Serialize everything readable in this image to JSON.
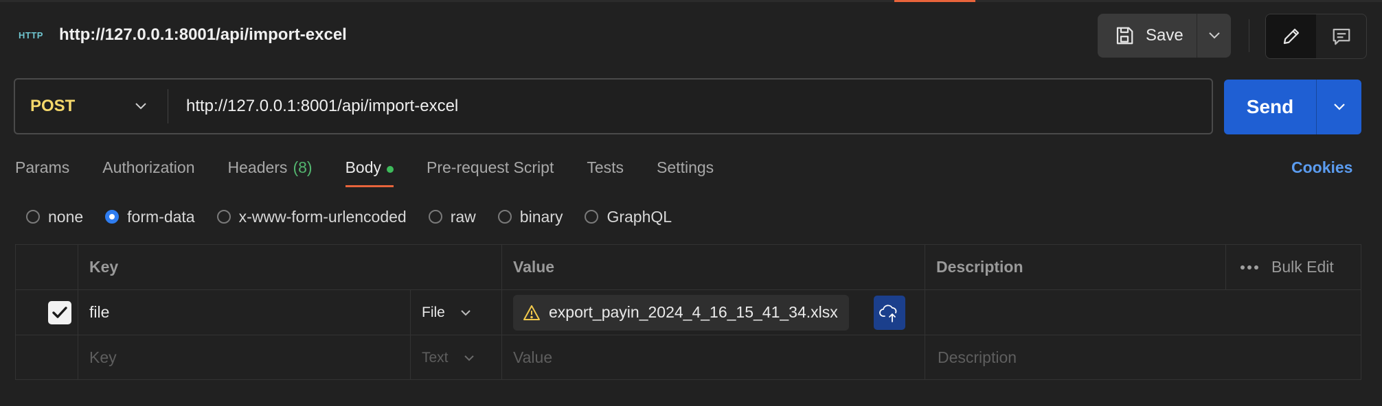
{
  "header": {
    "badge": "HTTP",
    "title": "http://127.0.0.1:8001/api/import-excel",
    "save_label": "Save"
  },
  "request": {
    "method": "POST",
    "url": "http://127.0.0.1:8001/api/import-excel",
    "send_label": "Send"
  },
  "tabs": [
    {
      "label": "Params"
    },
    {
      "label": "Authorization"
    },
    {
      "label": "Headers",
      "count": "(8)"
    },
    {
      "label": "Body"
    },
    {
      "label": "Pre-request Script"
    },
    {
      "label": "Tests"
    },
    {
      "label": "Settings"
    }
  ],
  "active_tab": "Body",
  "cookies_label": "Cookies",
  "body_types": [
    {
      "label": "none",
      "selected": false
    },
    {
      "label": "form-data",
      "selected": true
    },
    {
      "label": "x-www-form-urlencoded",
      "selected": false
    },
    {
      "label": "raw",
      "selected": false
    },
    {
      "label": "binary",
      "selected": false
    },
    {
      "label": "GraphQL",
      "selected": false
    }
  ],
  "table": {
    "headers": {
      "key": "Key",
      "value": "Value",
      "description": "Description",
      "bulk_edit": "Bulk Edit"
    },
    "rows": [
      {
        "checked": true,
        "key": "file",
        "type": "File",
        "value": "export_payin_2024_4_16_15_41_34.xlsx",
        "description": ""
      }
    ],
    "new_row": {
      "key_placeholder": "Key",
      "type": "Text",
      "value_placeholder": "Value",
      "description_placeholder": "Description"
    }
  },
  "colors": {
    "accent": "#e8643b",
    "send": "#1f5fd3",
    "method": "#f5d86b",
    "link": "#5b9cf0"
  }
}
